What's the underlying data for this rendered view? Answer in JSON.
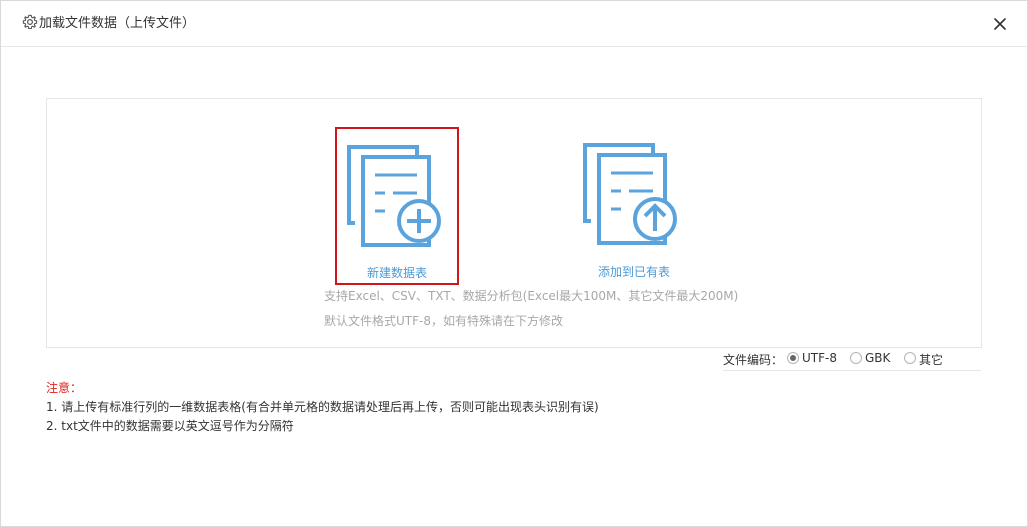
{
  "header": {
    "title": "加载文件数据（上传文件）",
    "icon": "gear-icon",
    "close_icon": "close-icon"
  },
  "upload": {
    "options": [
      {
        "label": "新建数据表",
        "icon": "new-table-icon",
        "selected": true
      },
      {
        "label": "添加到已有表",
        "icon": "upload-to-table-icon",
        "selected": false
      }
    ],
    "hint_formats": "支持Excel、CSV、TXT、数据分析包(Excel最大100M、其它文件最大200M)",
    "hint_encoding": "默认文件格式UTF-8，如有特殊请在下方修改"
  },
  "encoding": {
    "label": "文件编码：",
    "options": [
      "UTF-8",
      "GBK",
      "其它"
    ],
    "selected": "UTF-8"
  },
  "notes": {
    "title": "注意：",
    "items": [
      "1. 请上传有标准行列的一维数据表格(有合并单元格的数据请处理后再上传，否则可能出现表头识别有误)",
      "2. txt文件中的数据需要以英文逗号作为分隔符"
    ]
  },
  "colors": {
    "accent": "#4a9ad6",
    "selected_border": "#d0161b",
    "note_title": "#e02020",
    "hint": "#a8a8a8"
  }
}
